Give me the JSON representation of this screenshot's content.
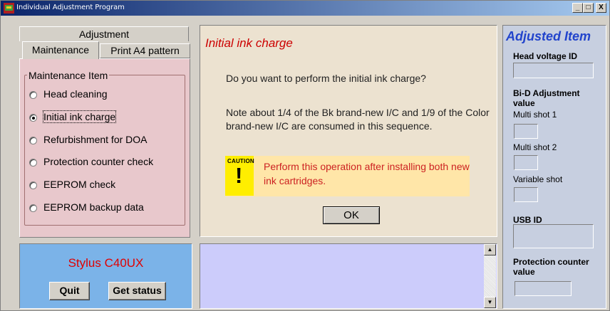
{
  "window": {
    "title": "Individual Adjustment Program",
    "buttons": {
      "min": "_",
      "max": "□",
      "close": "X"
    }
  },
  "tabs": {
    "top": "Adjustment",
    "maintenance": "Maintenance",
    "print": "Print A4 pattern"
  },
  "group": {
    "label": "Maintenance Item",
    "items": [
      {
        "label": "Head cleaning",
        "selected": false
      },
      {
        "label": "Initial ink charge",
        "selected": true
      },
      {
        "label": "Refurbishment for DOA",
        "selected": false
      },
      {
        "label": "Protection counter check",
        "selected": false
      },
      {
        "label": "EEPROM check",
        "selected": false
      },
      {
        "label": "EEPROM backup data",
        "selected": false
      }
    ]
  },
  "model": {
    "name": "Stylus C40UX",
    "quit": "Quit",
    "status": "Get status"
  },
  "center": {
    "title": "Initial ink charge",
    "question": "Do you want to perform the initial ink charge?",
    "note": "Note about 1/4 of the Bk brand-new I/C and 1/9 of the Color brand-new I/C are consumed in this sequence.",
    "caution_label": "CAUTION",
    "caution_symbol": "!",
    "caution_text": "Perform this operation after installing both new ink cartridges.",
    "ok": "OK"
  },
  "output": {
    "scroll_up": "▲",
    "scroll_down": "▼"
  },
  "adjusted": {
    "title": "Adjusted Item",
    "head_voltage": "Head voltage ID",
    "bid": "Bi-D Adjustment value",
    "multi1": "Multi shot 1",
    "multi2": "Multi shot 2",
    "variable": "Variable shot",
    "usb": "USB ID",
    "protection": "Protection counter value"
  },
  "colors": {
    "accent_red": "#cc0000",
    "accent_blue": "#2244cc",
    "panel_pink": "#e8c8cc",
    "panel_blue": "#7bb3e8",
    "caution_yellow": "#ffee00"
  }
}
